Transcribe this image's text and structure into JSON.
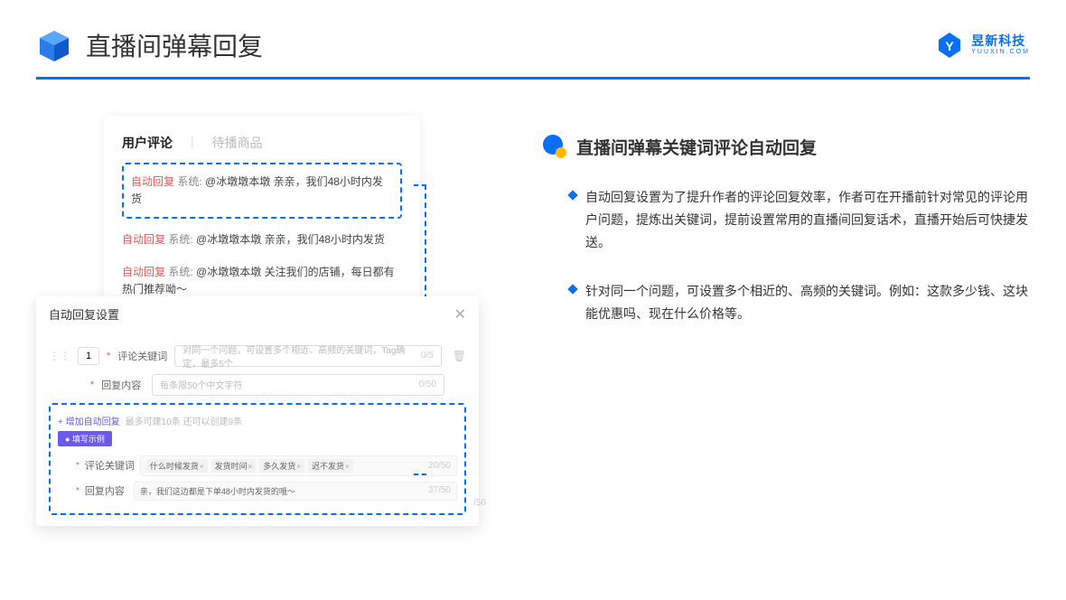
{
  "header": {
    "title": "直播间弹幕回复",
    "brand_name": "昱新科技",
    "brand_sub": "YUUXIN.COM"
  },
  "card1": {
    "tab_active": "用户评论",
    "tab_inactive": "待播商品",
    "rows": [
      {
        "auto": "自动回复",
        "sys": "系统:",
        "text": "@冰墩墩本墩 亲亲，我们48小时内发货"
      },
      {
        "auto": "自动回复",
        "sys": "系统:",
        "text": "@冰墩墩本墩 亲亲，我们48小时内发货"
      },
      {
        "auto": "自动回复",
        "sys": "系统:",
        "text": "@冰墩墩本墩 关注我们的店铺，每日都有热门推荐呦～"
      }
    ]
  },
  "card2": {
    "title": "自动回复设置",
    "num": "1",
    "label_keyword": "评论关键词",
    "placeholder_keyword": "对同一个问题，可设置多个相近、高频的关键词，Tag确定，最多5个",
    "counter_keyword": "0/5",
    "label_reply": "回复内容",
    "placeholder_reply": "每条限50个中文字符",
    "counter_reply": "0/50",
    "add_link": "+ 增加自动回复",
    "hint": "最多可建10条 还可以创建9条",
    "example_badge": "● 填写示例",
    "ex_label_keyword": "评论关键词",
    "ex_label_reply": "回复内容",
    "tags": [
      "什么时候发货",
      "发货时间",
      "多久发货",
      "迟不发货"
    ],
    "ex_counter_kw": "20/50",
    "ex_reply": "亲，我们这边都是下单48小时内发货的哦～",
    "ex_counter_reply": "37/50",
    "trailing_counter": "/50"
  },
  "right": {
    "section_title": "直播间弹幕关键词评论自动回复",
    "bullets": [
      "自动回复设置为了提升作者的评论回复效率，作者可在开播前针对常见的评论用户问题，提炼出关键词，提前设置常用的直播间回复话术，直播开始后可快捷发送。",
      "针对同一个问题，可设置多个相近的、高频的关键词。例如：这款多少钱、这块能优惠吗、现在什么价格等。"
    ]
  }
}
